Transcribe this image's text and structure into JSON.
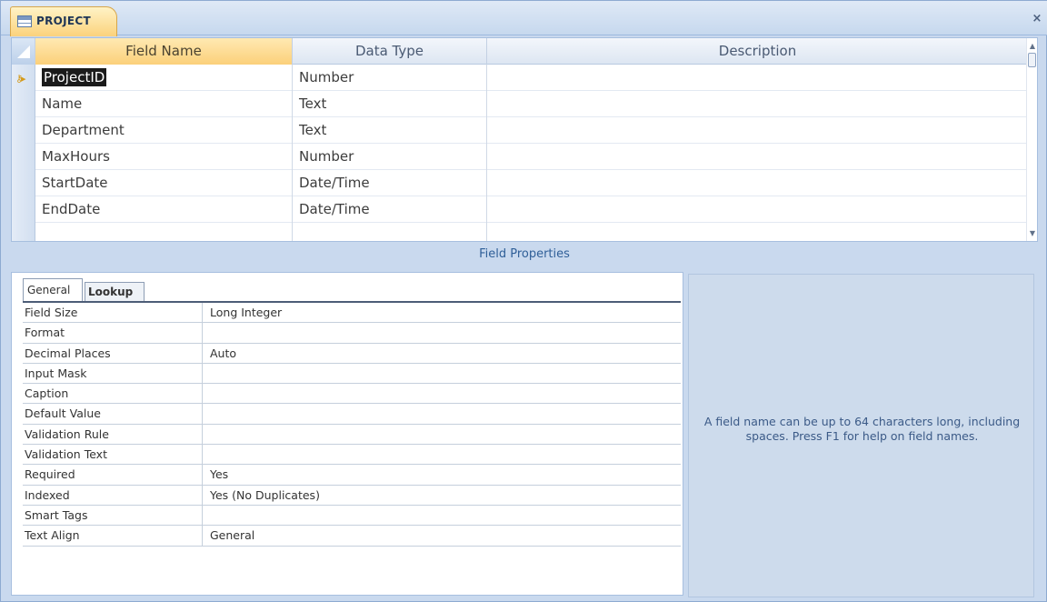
{
  "window": {
    "tab_title": "PROJECT",
    "close_glyph": "×",
    "icon": "table-icon"
  },
  "grid": {
    "columns": [
      "Field Name",
      "Data Type",
      "Description"
    ],
    "rows": [
      {
        "field_name": "ProjectID",
        "data_type": "Number",
        "description": "",
        "primary_key": true,
        "selected": true
      },
      {
        "field_name": "Name",
        "data_type": "Text",
        "description": ""
      },
      {
        "field_name": "Department",
        "data_type": "Text",
        "description": ""
      },
      {
        "field_name": "MaxHours",
        "data_type": "Number",
        "description": ""
      },
      {
        "field_name": "StartDate",
        "data_type": "Date/Time",
        "description": ""
      },
      {
        "field_name": "EndDate",
        "data_type": "Date/Time",
        "description": ""
      },
      {
        "field_name": "",
        "data_type": "",
        "description": ""
      }
    ]
  },
  "field_properties": {
    "title": "Field Properties",
    "tabs": [
      "General",
      "Lookup"
    ],
    "active_tab": "General",
    "rows": [
      {
        "label": "Field Size",
        "value": "Long Integer"
      },
      {
        "label": "Format",
        "value": ""
      },
      {
        "label": "Decimal Places",
        "value": "Auto"
      },
      {
        "label": "Input Mask",
        "value": ""
      },
      {
        "label": "Caption",
        "value": ""
      },
      {
        "label": "Default Value",
        "value": ""
      },
      {
        "label": "Validation Rule",
        "value": ""
      },
      {
        "label": "Validation Text",
        "value": ""
      },
      {
        "label": "Required",
        "value": "Yes"
      },
      {
        "label": "Indexed",
        "value": "Yes (No Duplicates)"
      },
      {
        "label": "Smart Tags",
        "value": ""
      },
      {
        "label": "Text Align",
        "value": "General"
      }
    ],
    "help_text": "A field name can be up to 64 characters long, including spaces.  Press F1 for help on field names."
  },
  "colors": {
    "active_tab": "#fbd27c",
    "panel_blue": "#cddbec",
    "help_text": "#3b5a87",
    "selection": "#1b1b1b"
  }
}
